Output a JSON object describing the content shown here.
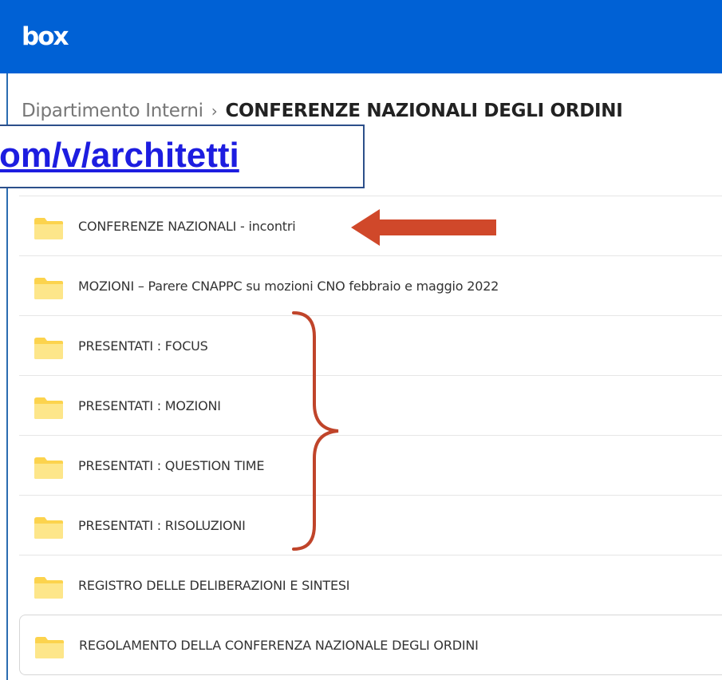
{
  "header": {
    "logo": "box",
    "brand_color": "#0061d5"
  },
  "breadcrumb": {
    "parent": "Dipartimento Interni",
    "separator": "›",
    "current": "CONFERENZE NAZIONALI DEGLI ORDINI"
  },
  "overlay": {
    "url_text": "om/v/architetti"
  },
  "folders": [
    {
      "name": "CONFERENZE NAZIONALI - incontri"
    },
    {
      "name": "MOZIONI – Parere CNAPPC su mozioni CNO febbraio e maggio 2022"
    },
    {
      "name": "PRESENTATI : FOCUS"
    },
    {
      "name": "PRESENTATI : MOZIONI"
    },
    {
      "name": "PRESENTATI : QUESTION TIME"
    },
    {
      "name": "PRESENTATI : RISOLUZIONI"
    },
    {
      "name": "REGISTRO DELLE DELIBERAZIONI E SINTESI"
    },
    {
      "name": "REGOLAMENTO DELLA CONFERENZA NAZIONALE DEGLI ORDINI"
    }
  ],
  "annotations": {
    "arrow_color": "#d0482a",
    "brace_color": "#c0442a"
  },
  "icons": {
    "folder": "folder-icon"
  }
}
